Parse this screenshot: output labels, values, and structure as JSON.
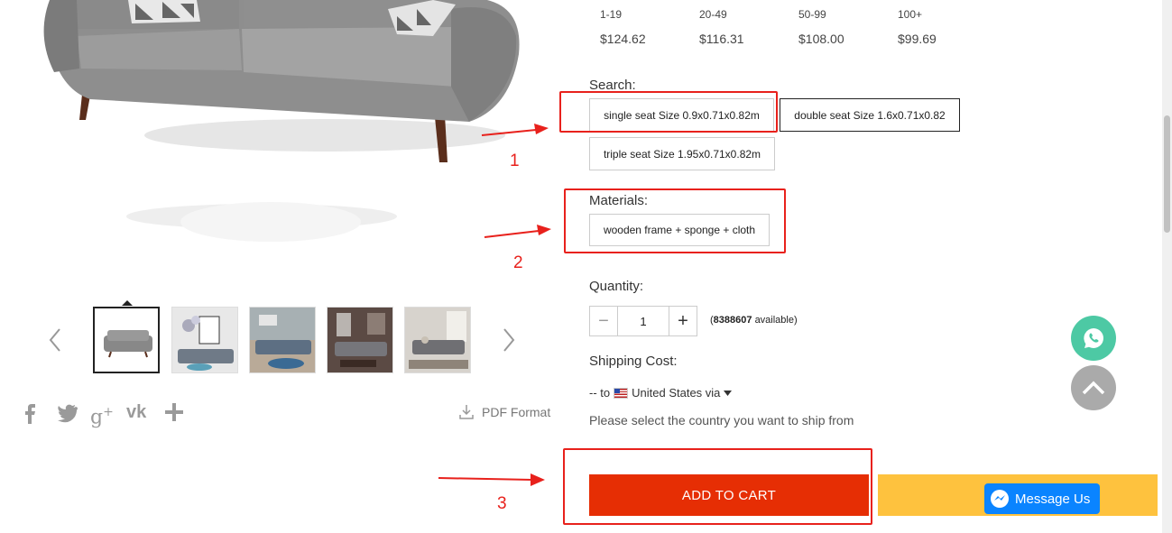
{
  "price_tiers": [
    {
      "range": "1-19",
      "price": "$124.62"
    },
    {
      "range": "20-49",
      "price": "$116.31"
    },
    {
      "range": "50-99",
      "price": "$108.00"
    },
    {
      "range": "100+",
      "price": "$99.69"
    }
  ],
  "search": {
    "label": "Search:",
    "options": [
      "single seat Size 0.9x0.71x0.82m",
      "double seat Size 1.6x0.71x0.82",
      "triple seat Size 1.95x0.71x0.82m"
    ],
    "selected_index": 1
  },
  "materials": {
    "label": "Materials:",
    "options": [
      "wooden frame + sponge + cloth"
    ]
  },
  "quantity": {
    "label": "Quantity:",
    "value": "1",
    "available_count": "8388607",
    "available_suffix": "available)",
    "available_prefix": "("
  },
  "shipping": {
    "label": "Shipping Cost:",
    "prefix": "-- to",
    "country": "United States via",
    "note": "Please select the country you want to ship from"
  },
  "actions": {
    "add_to_cart": "ADD TO CART",
    "messenger": "Message Us"
  },
  "pdf": {
    "label": "PDF Format"
  },
  "annotations": [
    "1",
    "2",
    "3"
  ],
  "colors": {
    "annotation_red": "#e8211c",
    "add_to_cart": "#e62e04",
    "buy_now": "#fec23e",
    "whatsapp": "#4dc9a4",
    "messenger": "#0a84ff"
  }
}
